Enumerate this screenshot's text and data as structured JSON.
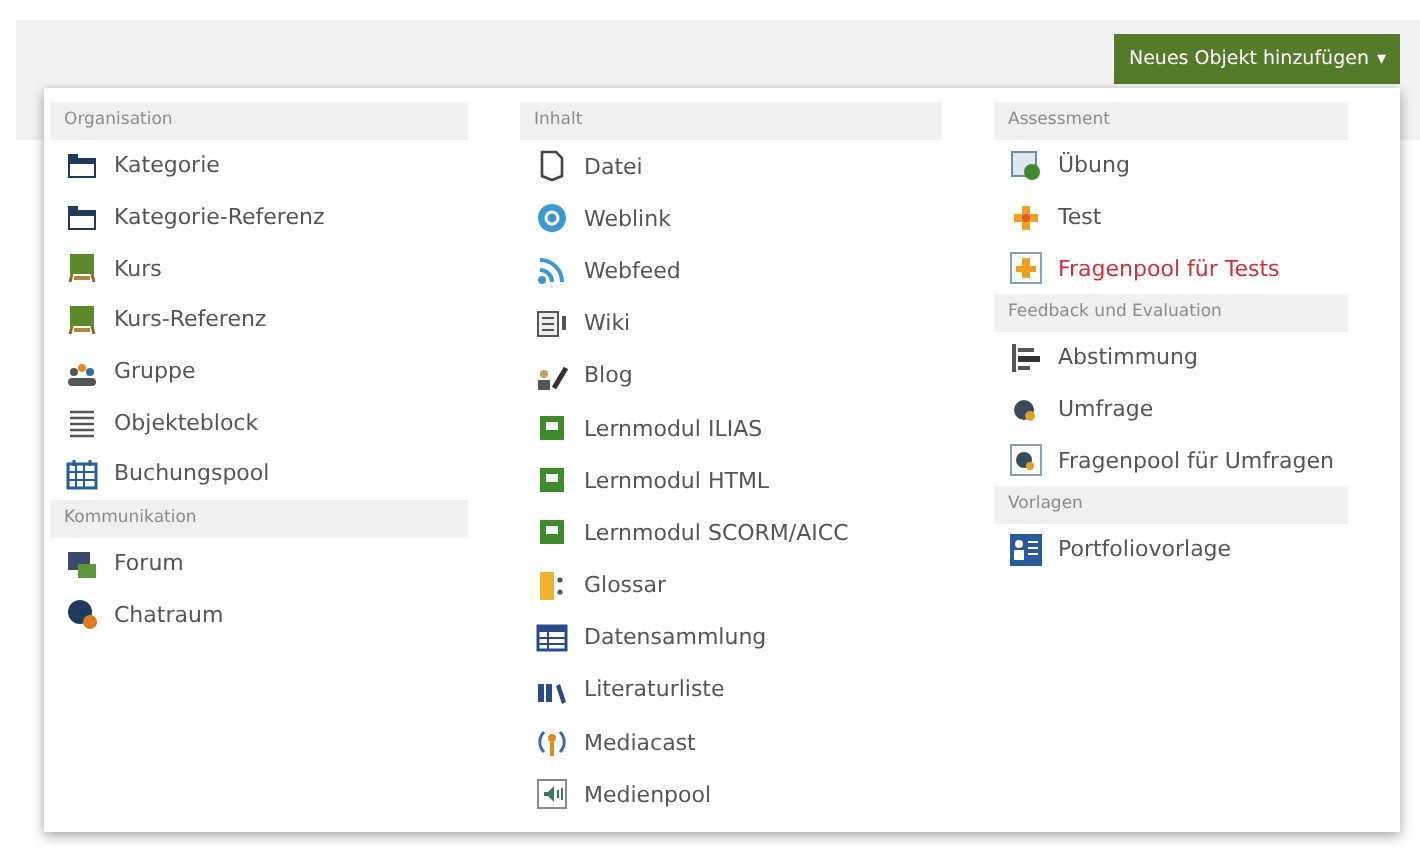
{
  "button": {
    "label": "Neues Objekt hinzufügen",
    "caret": "▾"
  },
  "columns": [
    {
      "groups": [
        {
          "title": "Organisation",
          "items": [
            {
              "label": "Kategorie",
              "kind": "folder",
              "selected": false
            },
            {
              "label": "Kategorie-Referenz",
              "kind": "folder",
              "selected": false
            },
            {
              "label": "Kurs",
              "kind": "board",
              "selected": false
            },
            {
              "label": "Kurs-Referenz",
              "kind": "board",
              "selected": false
            },
            {
              "label": "Gruppe",
              "kind": "people",
              "selected": false
            },
            {
              "label": "Objekteblock",
              "kind": "lines",
              "selected": false
            },
            {
              "label": "Buchungspool",
              "kind": "calendar",
              "selected": false
            }
          ]
        },
        {
          "title": "Kommunikation",
          "items": [
            {
              "label": "Forum",
              "kind": "forum",
              "selected": false
            },
            {
              "label": "Chatraum",
              "kind": "chat",
              "selected": false
            }
          ]
        }
      ]
    },
    {
      "groups": [
        {
          "title": "Inhalt",
          "items": [
            {
              "label": "Datei",
              "kind": "file",
              "selected": false
            },
            {
              "label": "Weblink",
              "kind": "globe",
              "selected": false
            },
            {
              "label": "Webfeed",
              "kind": "feed",
              "selected": false
            },
            {
              "label": "Wiki",
              "kind": "wiki",
              "selected": false
            },
            {
              "label": "Blog",
              "kind": "pen",
              "selected": false
            },
            {
              "label": "Lernmodul ILIAS",
              "kind": "module",
              "selected": false
            },
            {
              "label": "Lernmodul HTML",
              "kind": "module",
              "selected": false
            },
            {
              "label": "Lernmodul SCORM/AICC",
              "kind": "module",
              "selected": false
            },
            {
              "label": "Glossar",
              "kind": "glossary",
              "selected": false
            },
            {
              "label": "Datensammlung",
              "kind": "table",
              "selected": false
            },
            {
              "label": "Literaturliste",
              "kind": "books",
              "selected": false
            },
            {
              "label": "Mediacast",
              "kind": "broadcast",
              "selected": false
            },
            {
              "label": "Medienpool",
              "kind": "speaker",
              "selected": false
            }
          ]
        }
      ]
    },
    {
      "groups": [
        {
          "title": "Assessment",
          "items": [
            {
              "label": "Übung",
              "kind": "exercise",
              "selected": false
            },
            {
              "label": "Test",
              "kind": "puzzle",
              "selected": false
            },
            {
              "label": "Fragenpool für Tests",
              "kind": "puzzle-pool",
              "selected": true
            }
          ]
        },
        {
          "title": "Feedback und Evaluation",
          "items": [
            {
              "label": "Abstimmung",
              "kind": "poll",
              "selected": false
            },
            {
              "label": "Umfrage",
              "kind": "survey",
              "selected": false
            },
            {
              "label": "Fragenpool für Umfragen",
              "kind": "survey-pool",
              "selected": false
            }
          ]
        },
        {
          "title": "Vorlagen",
          "items": [
            {
              "label": "Portfoliovorlage",
              "kind": "template",
              "selected": false
            }
          ]
        }
      ]
    }
  ]
}
